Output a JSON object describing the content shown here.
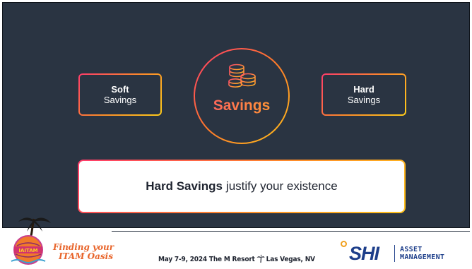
{
  "slide": {
    "center": {
      "title": "Savings",
      "icon": "coins-icon"
    },
    "soft_box": {
      "bold": "Soft",
      "light": "Savings"
    },
    "hard_box": {
      "bold": "Hard",
      "light": "Savings"
    },
    "statement": {
      "bold": "Hard Savings",
      "rest": "justify your existence"
    }
  },
  "footer": {
    "logo": {
      "badge": "IAITAM",
      "line1": "Finding your",
      "line2": "ITAM Oasis"
    },
    "event": {
      "dates": "May 7-9, 2024",
      "venue": "The M Resort",
      "location": "Las Vegas, NV",
      "icon": "palm-tree-icon"
    },
    "sponsor": {
      "brand": "SHI",
      "line1": "ASSET",
      "line2": "MANAGEMENT"
    }
  },
  "colors": {
    "slide_bg": "#2a3442",
    "accent_start": "#ff3b6b",
    "accent_mid": "#ff8a2a",
    "accent_end": "#ffcc1a",
    "logo_orange": "#e8642a",
    "sponsor_blue": "#1d3e8a"
  }
}
